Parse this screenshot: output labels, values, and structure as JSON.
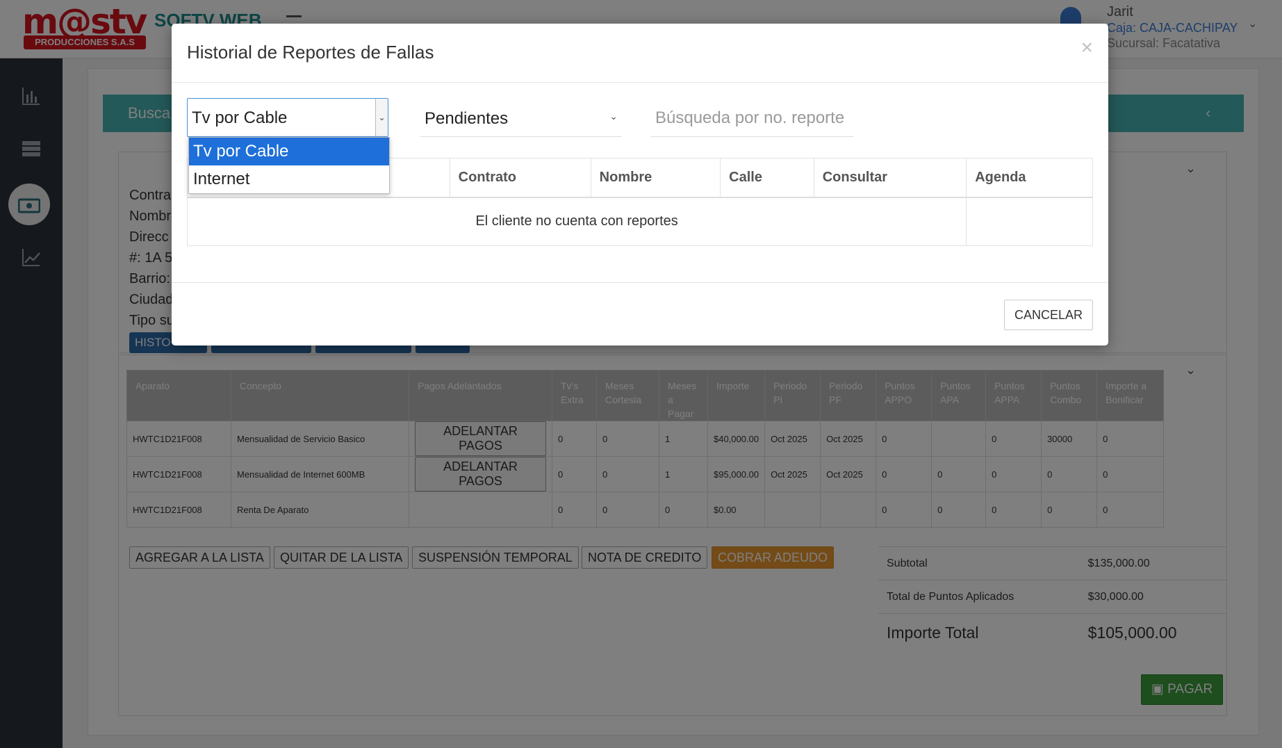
{
  "header": {
    "logo_text": "m@stv",
    "logo_sub": "PRODUCCIONES S.A.S",
    "app_name": "SOFTV WEB",
    "user": {
      "name": "Jarit",
      "caja": "Caja: CAJA-CACHIPAY",
      "sucursal": "Sucursal: Facatativa"
    }
  },
  "sidebar": {
    "items": [
      {
        "icon": "bar-chart-icon"
      },
      {
        "icon": "server-icon"
      },
      {
        "icon": "money-icon",
        "active": true
      },
      {
        "icon": "line-chart-icon"
      }
    ]
  },
  "background": {
    "search_band_label": "Busca",
    "info_lines": [
      "Contra",
      "Nombr",
      "Direcc",
      "#: 1A 5",
      "Barrio:",
      "Ciudad",
      "Tipo su"
    ],
    "chip_labels": [
      "HISTO",
      "",
      "",
      ""
    ],
    "table": {
      "headers": [
        "Aparato",
        "Concepto",
        "Pagos Adelantados",
        "Tv's Extra",
        "Meses Cortesia",
        "Meses a Pagar",
        "Importe",
        "Periodo PI",
        "Periodo PF",
        "Puntos APPO",
        "Puntos APA",
        "Puntos APPA",
        "Puntos Combo",
        "Importe a Bonificar"
      ],
      "rows": [
        [
          "HWTC1D21F008",
          "Mensualidad de Servicio Basico",
          "ADELANTAR PAGOS",
          "0",
          "0",
          "1",
          "$40,000.00",
          "Oct 2025",
          "Oct 2025",
          "0",
          "",
          "0",
          "30000",
          "0"
        ],
        [
          "HWTC1D21F008",
          "Mensualidad de Internet 600MB",
          "ADELANTAR PAGOS",
          "0",
          "0",
          "1",
          "$95,000.00",
          "Oct 2025",
          "Oct 2025",
          "0",
          "0",
          "0",
          "0",
          "0"
        ],
        [
          "HWTC1D21F008",
          "Renta De Aparato",
          "",
          "0",
          "0",
          "0",
          "$0.00",
          "",
          "",
          "0",
          "0",
          "0",
          "0",
          "0"
        ]
      ]
    },
    "actions": {
      "agregar": "AGREGAR A LA LISTA",
      "quitar": "QUITAR DE LA LISTA",
      "suspension": "SUSPENSIÓN TEMPORAL",
      "nota": "NOTA DE CREDITO",
      "cobrar": "COBRAR ADEUDO"
    },
    "totals": {
      "subtotal_label": "Subtotal",
      "subtotal_value": "$135,000.00",
      "puntos_label": "Total de Puntos Aplicados",
      "puntos_value": "$30,000.00",
      "total_label": "Importe Total",
      "total_value": "$105,000.00"
    },
    "pagar_label": "PAGAR"
  },
  "modal": {
    "title": "Historial de Reportes de Fallas",
    "close": "×",
    "service_select": {
      "value": "Tv por Cable",
      "options": [
        "Tv por Cable",
        "Internet"
      ]
    },
    "status_select": {
      "value": "Pendientes"
    },
    "search": {
      "placeholder": "Búsqueda por no. reporte"
    },
    "table": {
      "headers": [
        "",
        "Contrato",
        "Nombre",
        "Calle",
        "Consultar",
        "Agenda"
      ],
      "empty_message": "El cliente no cuenta con reportes"
    },
    "cancel_label": "CANCELAR"
  },
  "colors": {
    "brand_red": "#d2141e",
    "teal": "#48b3b3",
    "sidebar": "#2b313a",
    "selected_option": "#1e6fd9",
    "pay_green": "#3c9a3c",
    "cobrar_orange": "#e8962e"
  }
}
